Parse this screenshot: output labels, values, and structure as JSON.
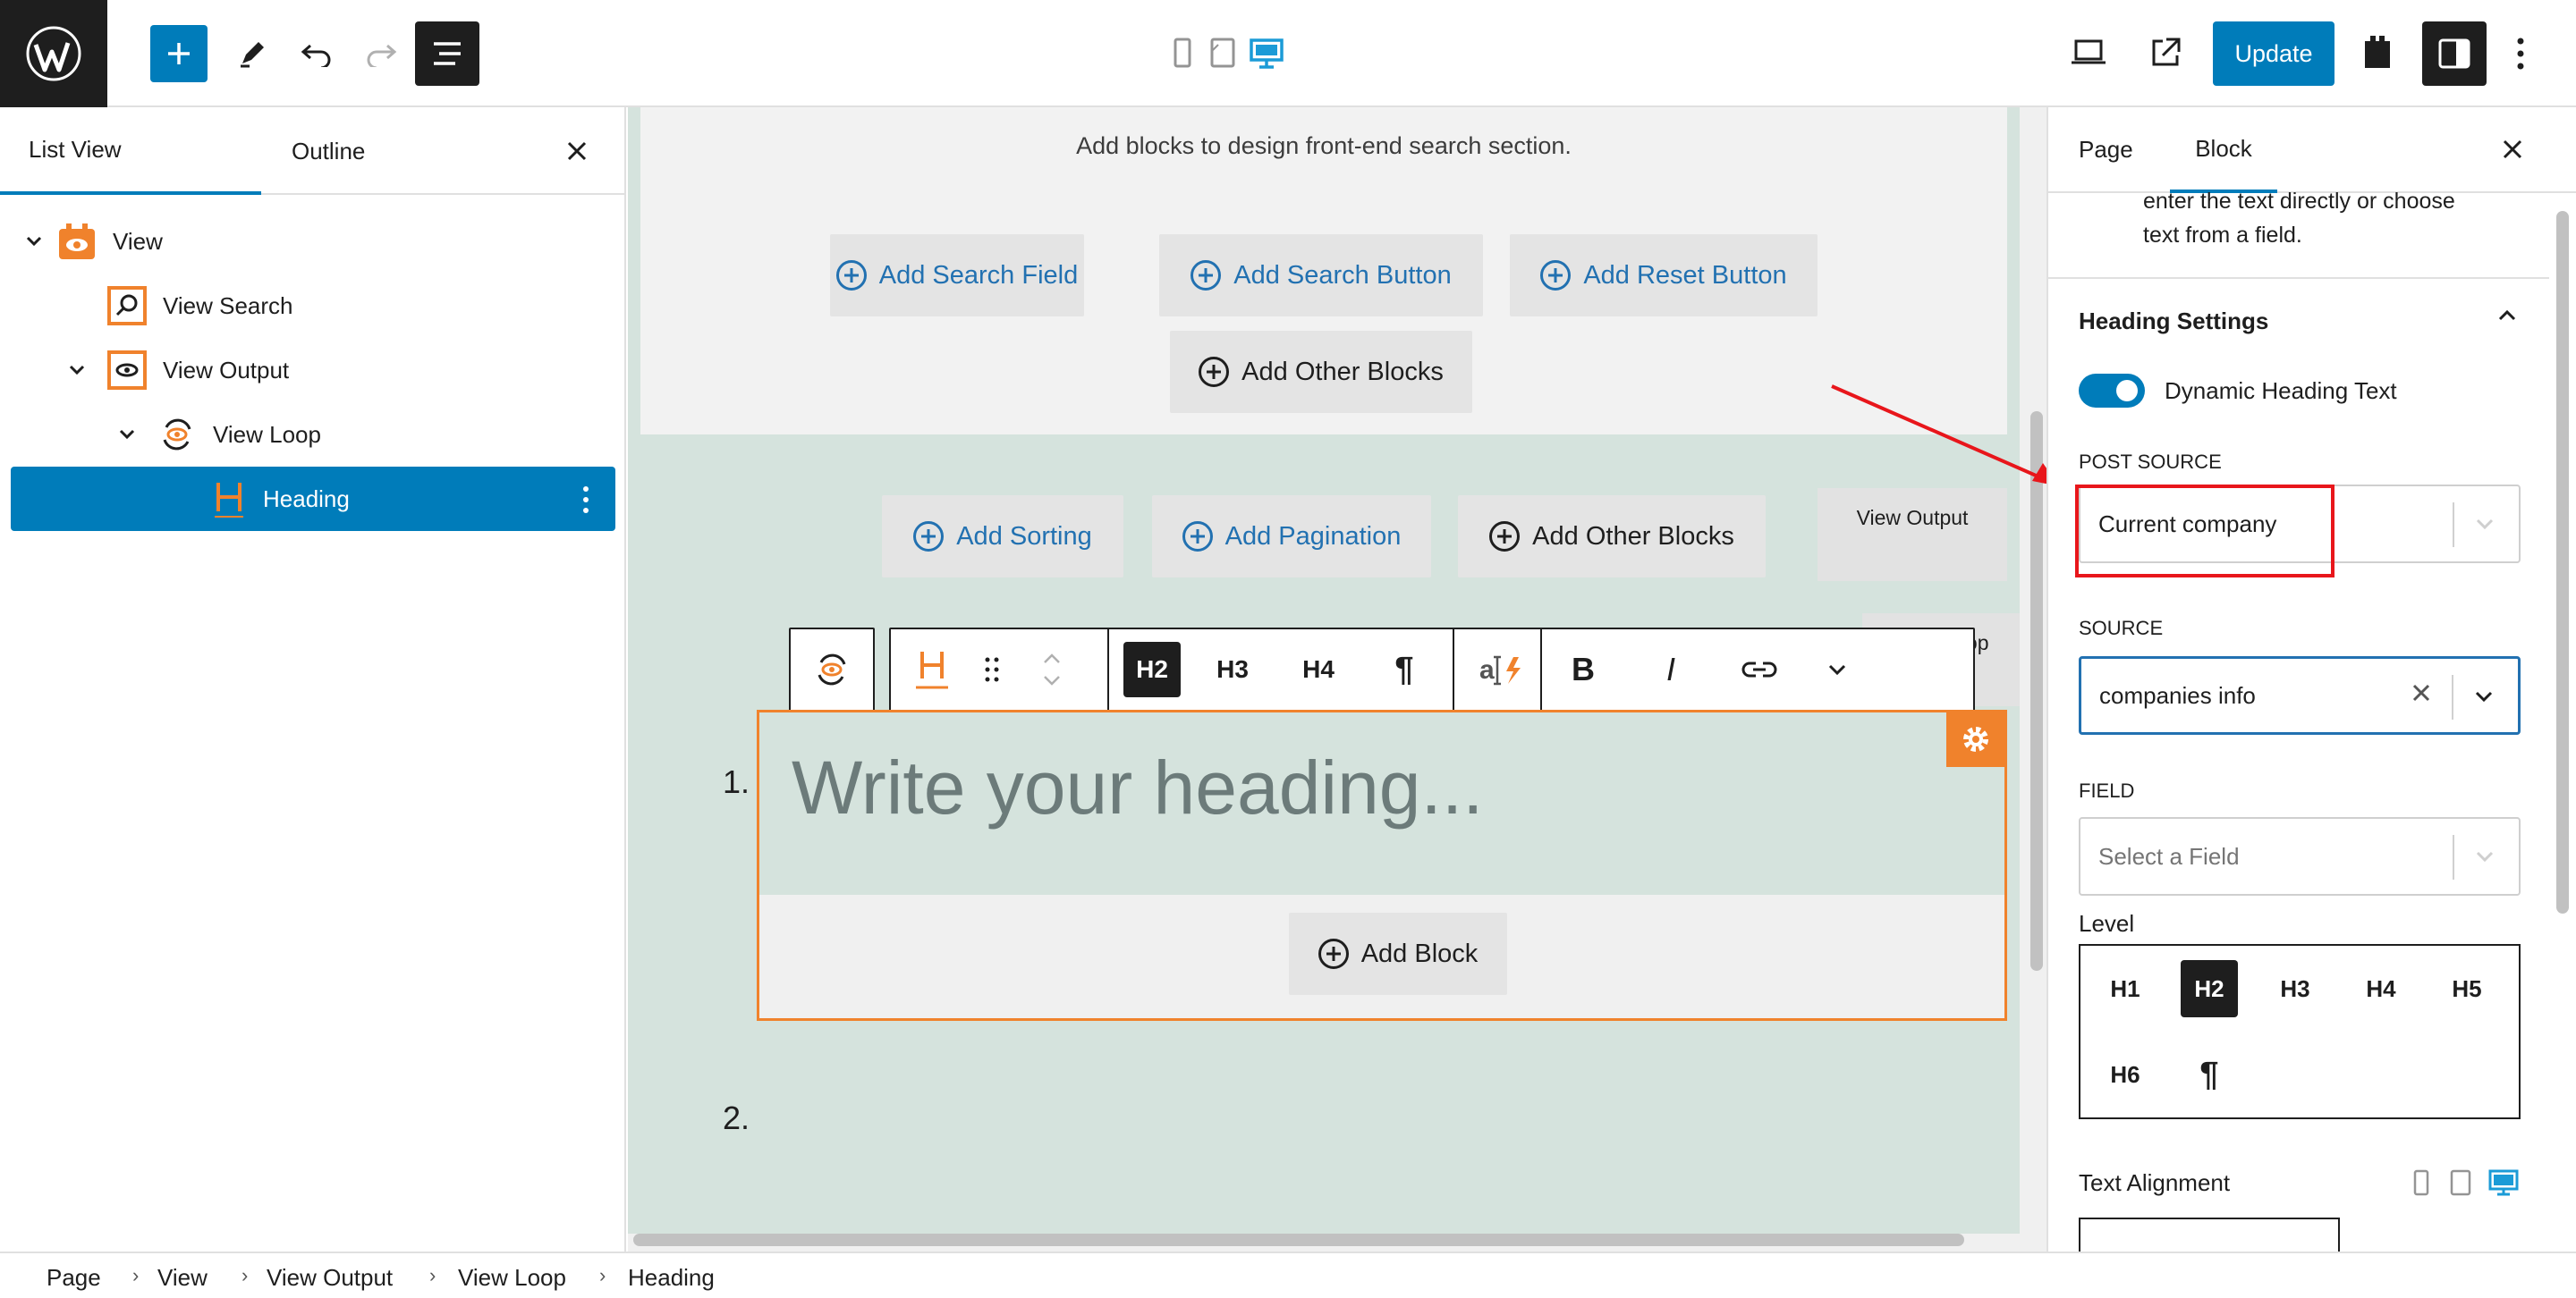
{
  "topbar": {
    "update_label": "Update"
  },
  "left_panel": {
    "tabs": [
      "List View",
      "Outline"
    ],
    "tree": [
      {
        "label": "View"
      },
      {
        "label": "View Search"
      },
      {
        "label": "View Output"
      },
      {
        "label": "View Loop"
      },
      {
        "label": "Heading"
      }
    ]
  },
  "canvas": {
    "search_hint": "Add blocks to design front-end search section.",
    "search_buttons": [
      "Add Search Field",
      "Add Search Button",
      "Add Reset Button"
    ],
    "search_other": "Add Other Blocks",
    "output_buttons": [
      "Add Sorting",
      "Add Pagination"
    ],
    "output_other": "Add Other Blocks",
    "view_output_label": "View Output",
    "view_loop_label": "View Loop",
    "toolbar_levels": [
      "H2",
      "H3",
      "H4",
      "¶"
    ],
    "toolbar_bold": "B",
    "toolbar_italic": "I",
    "heading_placeholder": "Write your heading...",
    "add_block": "Add Block",
    "list_numbers": [
      "1.",
      "2."
    ]
  },
  "right_panel": {
    "tabs": [
      "Page",
      "Block"
    ],
    "help_text_line1": "enter the text directly or choose",
    "help_text_line2": "text from a field.",
    "section_title": "Heading Settings",
    "toggle_label": "Dynamic Heading Text",
    "toggle_on": true,
    "post_source_label": "POST SOURCE",
    "post_source_value": "Current company",
    "source_label": "SOURCE",
    "source_value": "companies info",
    "field_label": "FIELD",
    "field_placeholder": "Select a Field",
    "level_label": "Level",
    "levels": [
      "H1",
      "H2",
      "H3",
      "H4",
      "H5",
      "H6",
      "¶"
    ],
    "active_level": "H2",
    "text_alignment_label": "Text Alignment"
  },
  "breadcrumb": [
    "Page",
    "View",
    "View Output",
    "View Loop",
    "Heading"
  ],
  "colors": {
    "accent": "#007cba",
    "brand_orange": "#f0822c",
    "highlight_red": "#e8161b",
    "canvas_green": "#d5e3dd"
  }
}
